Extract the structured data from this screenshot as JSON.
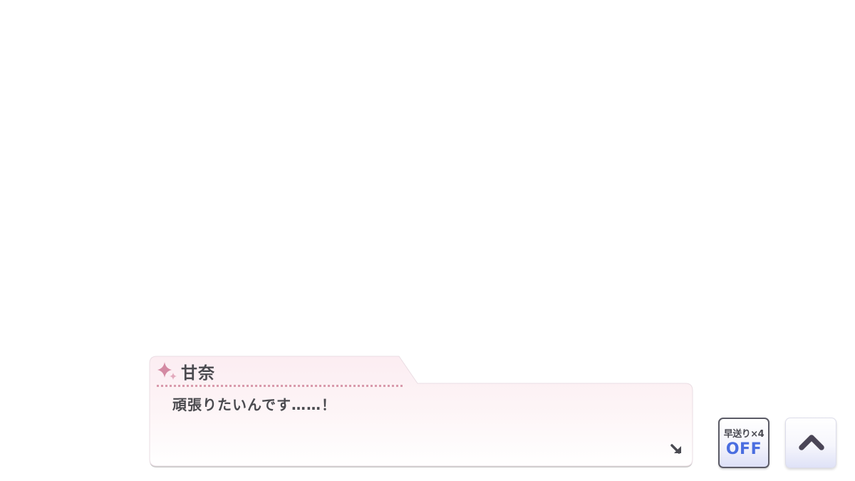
{
  "dialogue": {
    "speaker": "甘奈",
    "text": "頑張りたいんです……！"
  },
  "controls": {
    "fast_forward_label": "早送り×4",
    "fast_forward_state": "OFF"
  },
  "icons": {
    "speaker": "sparkle-icon",
    "advance": "advance-arrow-icon",
    "hide": "chevron-up-icon"
  },
  "colors": {
    "background": "#ffffff",
    "dialogue_bg": "#fdf2f5",
    "text": "#4a4a4f",
    "accent_pink": "#d99aac",
    "ff_state": "#4a6ee0"
  }
}
